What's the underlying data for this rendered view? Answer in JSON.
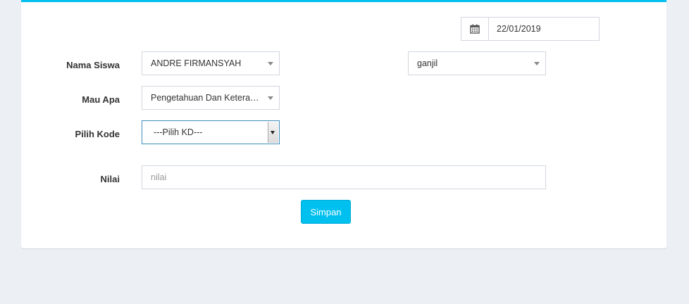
{
  "form": {
    "date": "22/01/2019",
    "nama_siswa": {
      "label": "Nama Siswa",
      "selected": "ANDRE FIRMANSYAH"
    },
    "semester": {
      "selected": "ganjil"
    },
    "mau_apa": {
      "label": "Mau Apa",
      "selected": "Pengetahuan Dan Keterampilan"
    },
    "pilih_kode": {
      "label": "Pilih Kode",
      "selected": "---Pilih KD---"
    },
    "nilai": {
      "label": "Nilai",
      "placeholder": "nilai",
      "value": ""
    },
    "submit_label": "Simpan"
  },
  "icons": {
    "date": "calendar-icon",
    "dropdown": "caret-down-icon"
  },
  "colors": {
    "accent": "#00c0ef",
    "page_background": "#ecf0f5",
    "focus_border": "#3c8dbc"
  }
}
